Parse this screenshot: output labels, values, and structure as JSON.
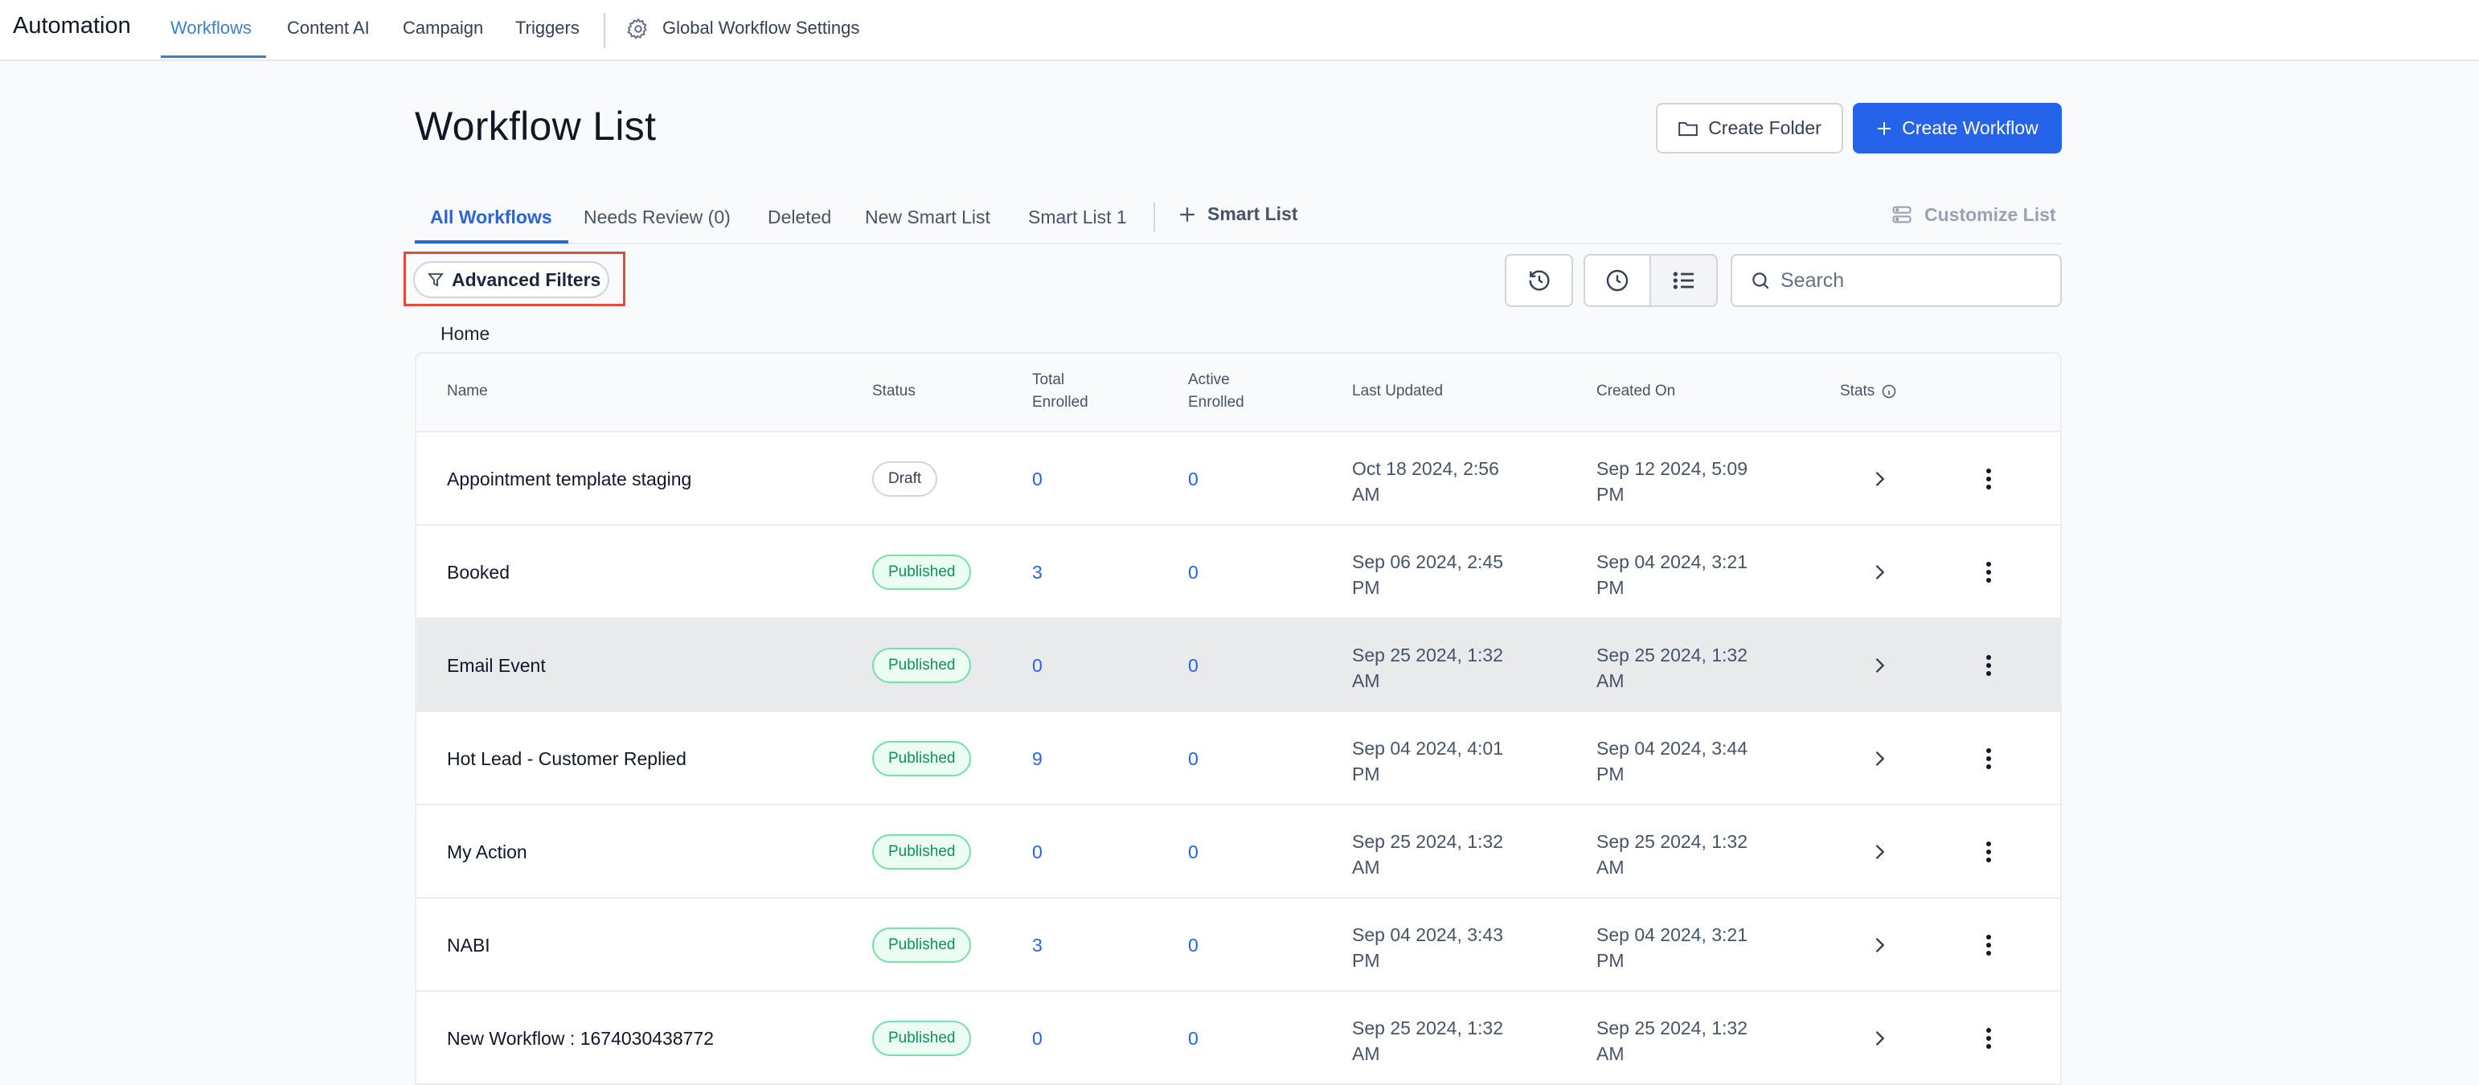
{
  "app": {
    "brand": "Automation",
    "nav": [
      "Workflows",
      "Content AI",
      "Campaign",
      "Triggers"
    ],
    "global_settings": "Global Workflow Settings"
  },
  "header": {
    "title": "Workflow List",
    "create_folder": "Create Folder",
    "create_workflow": "Create Workflow"
  },
  "tabs": [
    "All Workflows",
    "Needs Review (0)",
    "Deleted",
    "New Smart List",
    "Smart List 1"
  ],
  "smart_list_add": "Smart List",
  "customize_list": "Customize List",
  "filters": {
    "advanced_filters": "Advanced Filters",
    "search_placeholder": "Search"
  },
  "breadcrumb": "Home",
  "table": {
    "columns": {
      "name": "Name",
      "status": "Status",
      "total_1": "Total",
      "total_2": "Enrolled",
      "active_1": "Active",
      "active_2": "Enrolled",
      "last_updated": "Last Updated",
      "created_on": "Created On",
      "stats": "Stats"
    },
    "rows": [
      {
        "name": "Appointment template staging",
        "status": "Draft",
        "total": "0",
        "active": "0",
        "updated_1": "Oct 18 2024, 2:56",
        "updated_2": "AM",
        "created_1": "Sep 12 2024, 5:09",
        "created_2": "PM"
      },
      {
        "name": "Booked",
        "status": "Published",
        "total": "3",
        "active": "0",
        "updated_1": "Sep 06 2024, 2:45",
        "updated_2": "PM",
        "created_1": "Sep 04 2024, 3:21",
        "created_2": "PM"
      },
      {
        "name": "Email Event",
        "status": "Published",
        "total": "0",
        "active": "0",
        "updated_1": "Sep 25 2024, 1:32",
        "updated_2": "AM",
        "created_1": "Sep 25 2024, 1:32",
        "created_2": "AM"
      },
      {
        "name": "Hot Lead - Customer Replied",
        "status": "Published",
        "total": "9",
        "active": "0",
        "updated_1": "Sep 04 2024, 4:01",
        "updated_2": "PM",
        "created_1": "Sep 04 2024, 3:44",
        "created_2": "PM"
      },
      {
        "name": "My Action",
        "status": "Published",
        "total": "0",
        "active": "0",
        "updated_1": "Sep 25 2024, 1:32",
        "updated_2": "AM",
        "created_1": "Sep 25 2024, 1:32",
        "created_2": "AM"
      },
      {
        "name": "NABI",
        "status": "Published",
        "total": "3",
        "active": "0",
        "updated_1": "Sep 04 2024, 3:43",
        "updated_2": "PM",
        "created_1": "Sep 04 2024, 3:21",
        "created_2": "PM"
      },
      {
        "name": "New Workflow : 1674030438772",
        "status": "Published",
        "total": "0",
        "active": "0",
        "updated_1": "Sep 25 2024, 1:32",
        "updated_2": "AM",
        "created_1": "Sep 25 2024, 1:32",
        "created_2": "AM"
      }
    ]
  },
  "colors": {
    "primary": "#2563eb",
    "nav_active": "#3b82c4",
    "published_text": "#079455",
    "published_bg": "#ecfdf3",
    "highlight_border": "#e24b3b"
  },
  "icons": [
    "gear-icon",
    "folder-icon",
    "plus-icon",
    "customize-icon",
    "filter-icon",
    "history-icon",
    "clock-icon",
    "list-icon",
    "search-icon",
    "info-icon",
    "chevron-right-icon",
    "more-vertical-icon"
  ]
}
